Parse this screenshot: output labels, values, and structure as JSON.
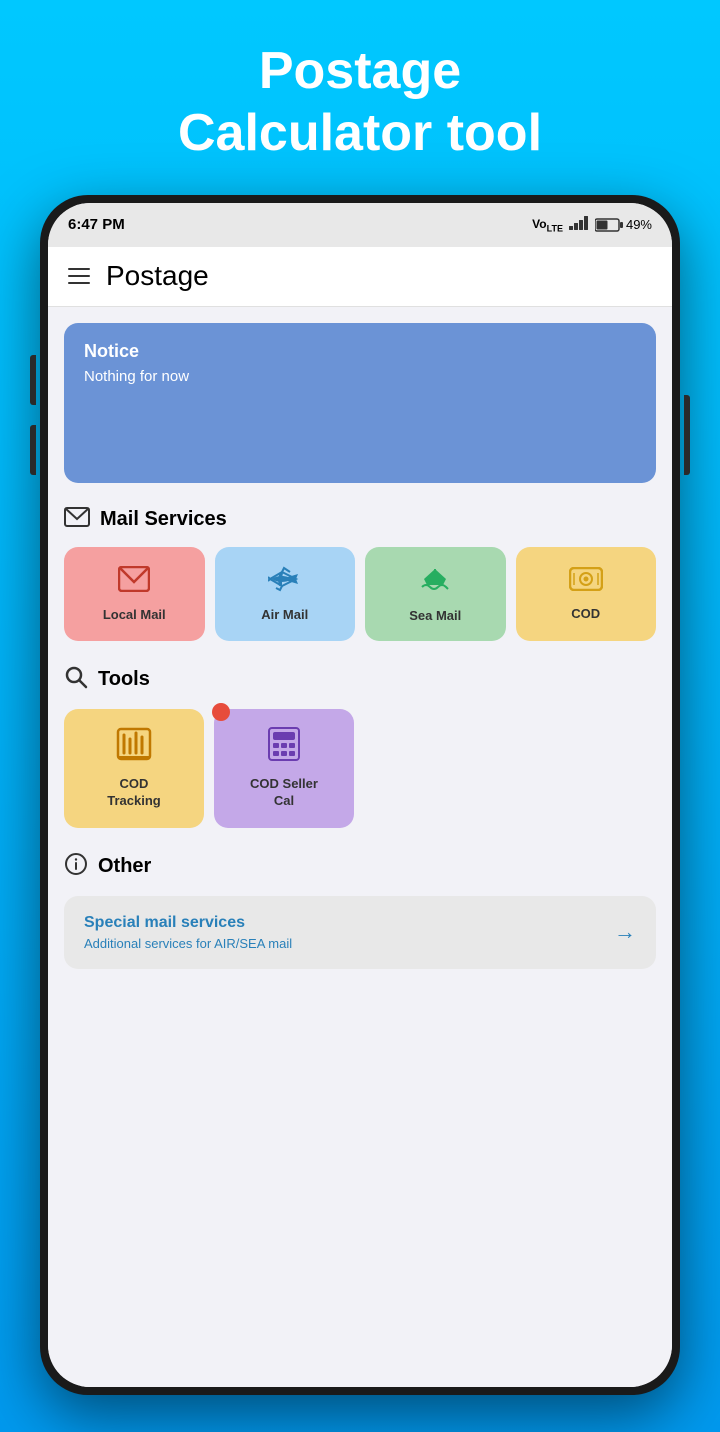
{
  "app_title": {
    "line1": "Postage",
    "line2": "Calculator tool"
  },
  "status_bar": {
    "time": "6:47 PM",
    "network": "VoLTE",
    "signal": "▂▄▆█",
    "battery": "49%"
  },
  "header": {
    "title": "Postage"
  },
  "notice": {
    "title": "Notice",
    "text": "Nothing for now"
  },
  "mail_services": {
    "section_title": "Mail Services",
    "items": [
      {
        "id": "local-mail",
        "label": "Local Mail"
      },
      {
        "id": "air-mail",
        "label": "Air Mail"
      },
      {
        "id": "sea-mail",
        "label": "Sea Mail"
      },
      {
        "id": "cod",
        "label": "COD"
      }
    ]
  },
  "tools": {
    "section_title": "Tools",
    "items": [
      {
        "id": "cod-tracking",
        "label": "COD\nTracking"
      },
      {
        "id": "cod-seller",
        "label": "COD Seller\nCal"
      }
    ]
  },
  "other": {
    "section_title": "Other",
    "card_title": "Special mail services",
    "card_subtitle": "Additional services for AIR/SEA mail"
  }
}
